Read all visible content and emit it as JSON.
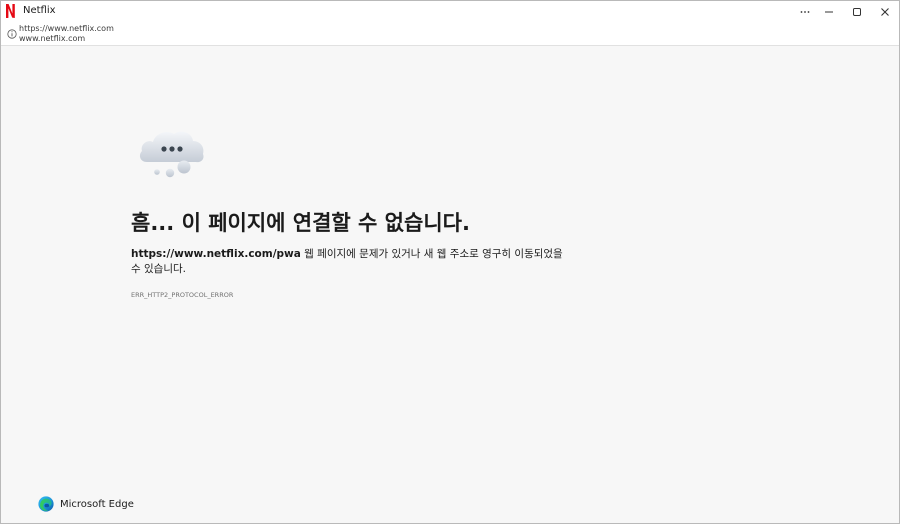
{
  "window": {
    "title": "Netflix",
    "controls": {
      "more": "more-icon",
      "minimize": "minimize-icon",
      "maximize": "maximize-icon",
      "close": "close-icon"
    }
  },
  "address_bar": {
    "url": "https://www.netflix.com",
    "host": "www.netflix.com",
    "icon": "info-icon"
  },
  "error": {
    "icon": "cloud-icon",
    "heading": "흠... 이 페이지에 연결할 수 없습니다.",
    "url": "https://www.netflix.com/pwa",
    "message": " 웹 페이지에 문제가 있거나 새 웹 주소로 영구히 이동되었을 수 있습니다.",
    "code": "ERR_HTTP2_PROTOCOL_ERROR"
  },
  "footer": {
    "brand": "Microsoft Edge",
    "icon": "edge-logo-icon"
  },
  "colors": {
    "brand_red": "#e50914",
    "page_bg": "#f7f7f7",
    "text": "#1b1b1b"
  }
}
